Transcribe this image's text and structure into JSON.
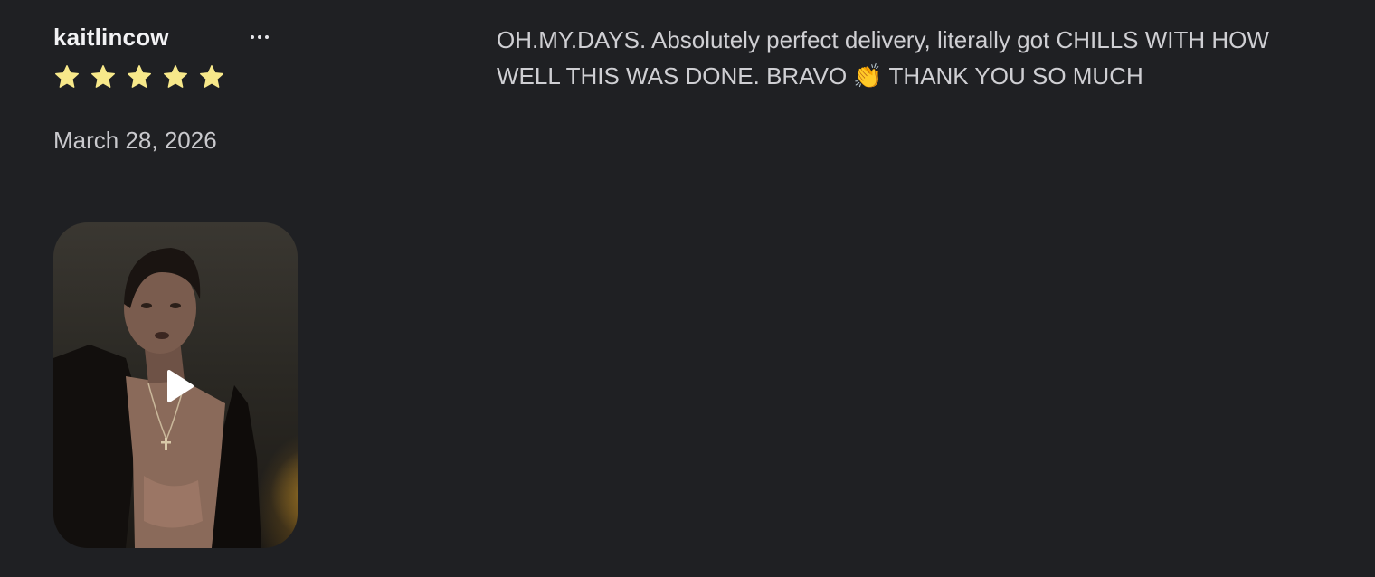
{
  "review": {
    "author": "kaitlincow",
    "more_label": "...",
    "rating": 5,
    "rating_max": 5,
    "star_color": "#f7e88a",
    "date": "March 28, 2026",
    "text_part1": "OH.MY.DAYS. Absolutely perfect delivery, literally got CHILLS WITH HOW WELL THIS WAS DONE. BRAVO ",
    "emoji": "👏",
    "text_part2": " THANK YOU SO MUCH",
    "media": {
      "type": "video",
      "icon": "play-icon"
    }
  }
}
